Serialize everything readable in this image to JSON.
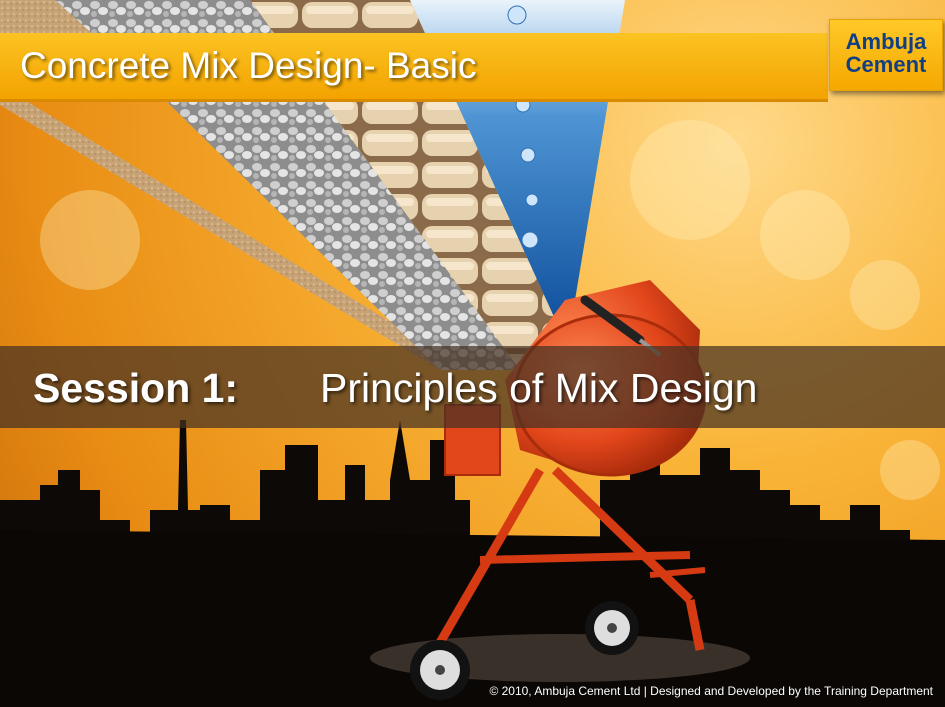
{
  "title": "Concrete Mix Design- Basic",
  "logo": {
    "line1": "Ambuja",
    "line2": "Cement"
  },
  "session": {
    "label": "Session 1:",
    "title": "Principles of Mix Design"
  },
  "footer": "© 2010, Ambuja Cement Ltd | Designed and Developed by the Training Department",
  "colors": {
    "accent": "#f7b21b",
    "logo_text": "#123f84",
    "background": "#f9b437"
  }
}
